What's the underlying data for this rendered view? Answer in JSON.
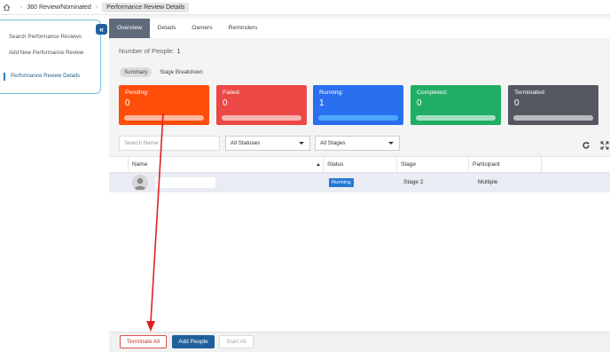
{
  "breadcrumb": {
    "home_icon": "home-icon",
    "items": [
      "360 Review/Nominated",
      "Performance Review Details"
    ]
  },
  "sidebar": {
    "collapse_icon": "double-chevron-left-icon",
    "items": [
      {
        "label": "Search Performance Reviews"
      },
      {
        "label": "Add New Performance Review"
      },
      {
        "label": "Performance Review Details"
      }
    ]
  },
  "tabs": [
    "Overview",
    "Details",
    "Owners",
    "Reminders"
  ],
  "people": {
    "label": "Number of People:",
    "count": "1"
  },
  "subtabs": [
    "Summary",
    "Stage Breakdown"
  ],
  "stats": [
    {
      "label": "Pending:",
      "value": "0",
      "color": "#ff4d0a"
    },
    {
      "label": "Failed:",
      "value": "0",
      "color": "#ec4845"
    },
    {
      "label": "Running:",
      "value": "1",
      "color": "#2a6ff0"
    },
    {
      "label": "Completed:",
      "value": "0",
      "color": "#1fae64"
    },
    {
      "label": "Terminated:",
      "value": "0",
      "color": "#555860"
    }
  ],
  "filters": {
    "search_placeholder": "Search Name",
    "status_select": "All Statuses",
    "stage_select": "All Stages"
  },
  "table": {
    "columns": [
      "Name",
      "Status",
      "Stage",
      "Participant"
    ],
    "rows": [
      {
        "status": "Running",
        "stage": "Stage 2",
        "participant": "Multiple"
      }
    ]
  },
  "footer": {
    "terminate": "Terminate All",
    "add": "Add People",
    "start": "Start All"
  },
  "colors": {
    "accent": "#1f5f9c",
    "annotation_arrow": "#e02020"
  }
}
